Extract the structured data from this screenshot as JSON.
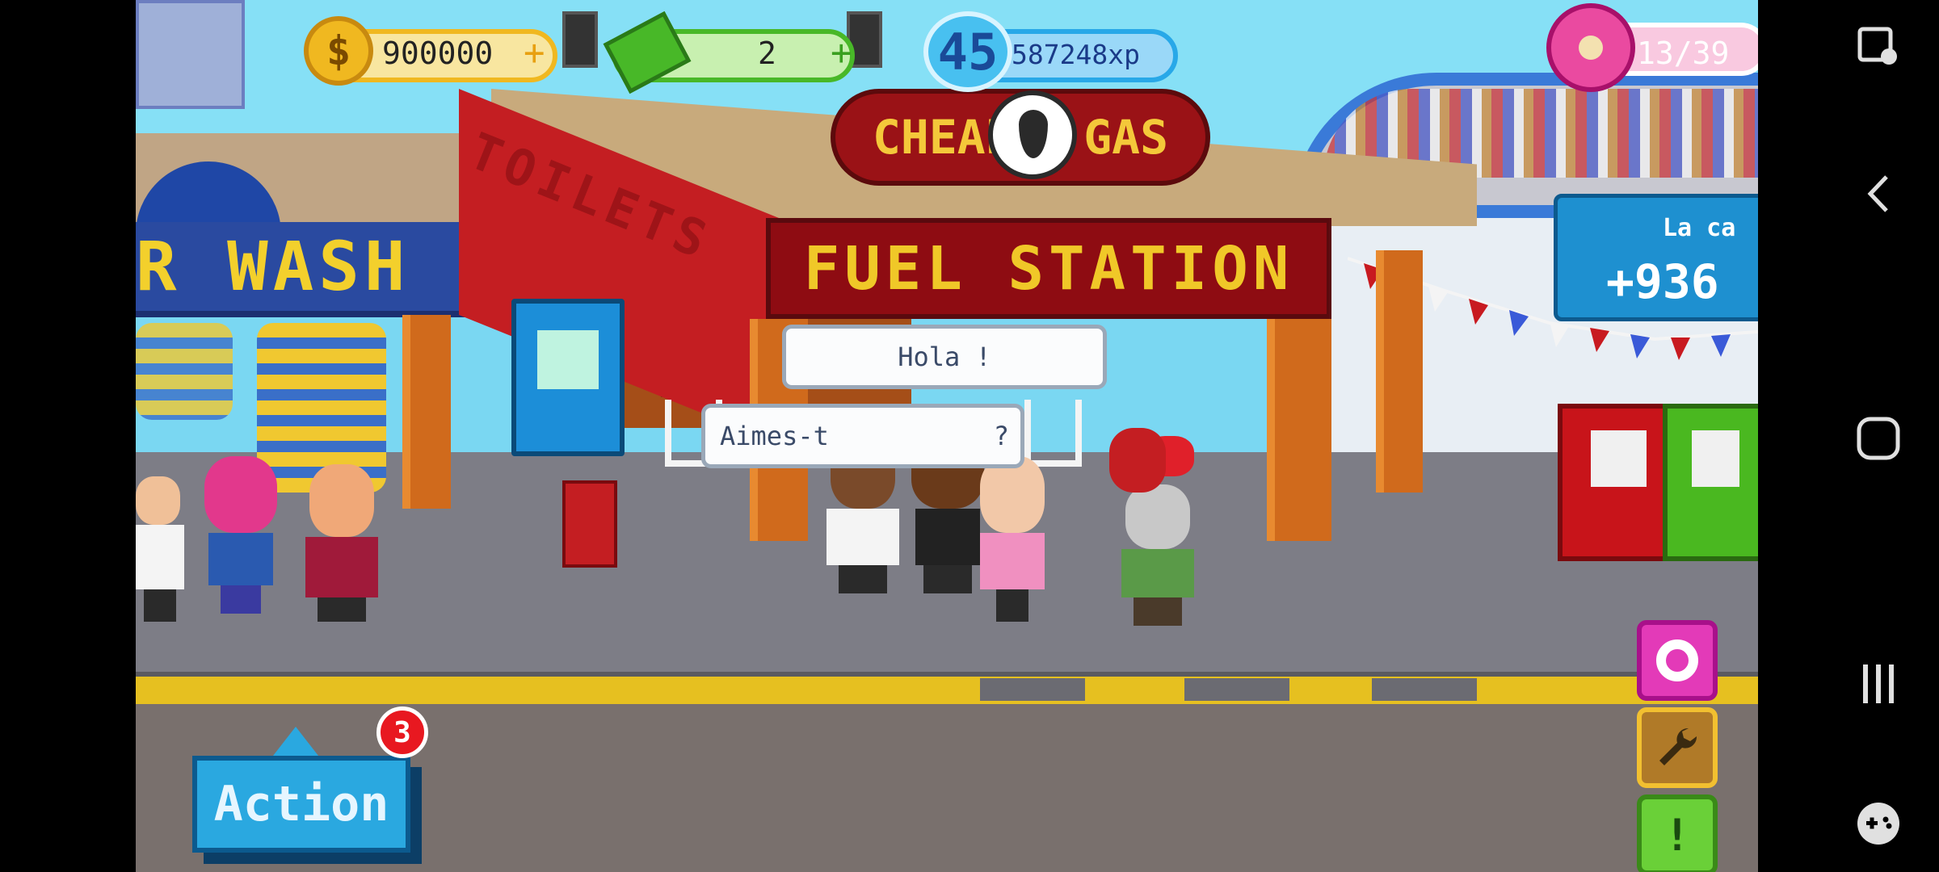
{
  "hud": {
    "coins": "900000",
    "coin_plus": "+",
    "cash": "2",
    "cash_plus": "+",
    "level": "45",
    "xp": "587248xp",
    "donuts": "13/39"
  },
  "signs": {
    "car_wash": "R WASH",
    "toilets": "TOILETS",
    "fuel_station": "FUEL STATION",
    "cheap": "CHEAP",
    "gas": "GAS"
  },
  "ad_panel": {
    "title": "La ca",
    "amount": "+936"
  },
  "dialog": {
    "hola": "Hola !",
    "aimes": "Aimes-t",
    "aimes_end": "?"
  },
  "action": {
    "label": "Action",
    "badge_count": "3"
  },
  "side_buttons": [
    "donut-icon",
    "wrench-icon",
    "exclamation-icon"
  ],
  "side_button_labels": {
    "alert": "!"
  },
  "system_nav": [
    "screenshot-icon",
    "back-icon",
    "home-icon",
    "recents-icon",
    "game-controller-icon"
  ],
  "colors": {
    "sky": "#86e0f6",
    "road": "#7d7d86",
    "curb": "#e6c020",
    "fuel_sign": "#8e0c12",
    "action_button": "#2aa8e0"
  }
}
